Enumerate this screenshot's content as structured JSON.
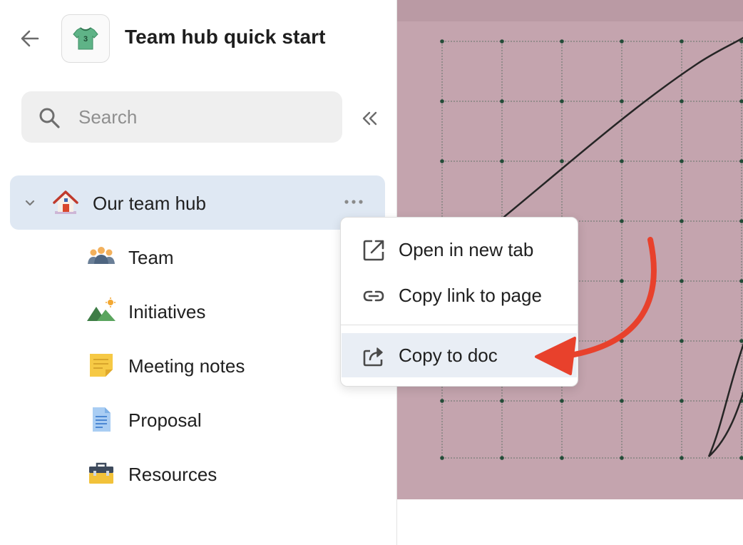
{
  "header": {
    "title": "Team hub quick start",
    "back_icon": "arrow-left-icon",
    "doc_icon": "jersey-icon",
    "doc_icon_text": "3"
  },
  "search": {
    "placeholder": "Search",
    "value": ""
  },
  "sidebar": {
    "collapse_icon": "double-chevron-left-icon",
    "items": [
      {
        "label": "Our team hub",
        "icon": "house-icon",
        "expanded": true,
        "active": true
      },
      {
        "label": "Team",
        "icon": "people-icon"
      },
      {
        "label": "Initiatives",
        "icon": "mountain-icon"
      },
      {
        "label": "Meeting notes",
        "icon": "sticky-note-icon"
      },
      {
        "label": "Proposal",
        "icon": "document-icon"
      },
      {
        "label": "Resources",
        "icon": "toolbox-icon"
      }
    ]
  },
  "context_menu": {
    "items": [
      {
        "label": "Open in new tab",
        "icon": "external-link-icon"
      },
      {
        "label": "Copy link to page",
        "icon": "link-icon"
      },
      {
        "label": "Copy to doc",
        "icon": "share-icon",
        "highlighted": true
      }
    ]
  },
  "colors": {
    "active_item_bg": "#dfe8f3",
    "canvas_bg": "#c4a4ae",
    "annotation_arrow": "#e8412c"
  }
}
